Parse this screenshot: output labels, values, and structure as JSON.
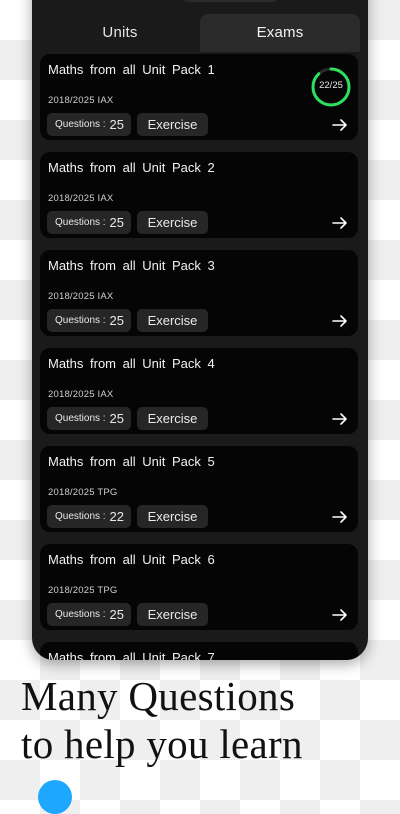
{
  "tabs": [
    {
      "label": "Units",
      "active": false
    },
    {
      "label": "Exams",
      "active": true
    }
  ],
  "cards": [
    {
      "title": "Maths from all Unit Pack 1",
      "meta": "2018/2025 IAX",
      "questions_label": "Questions :",
      "questions": "25",
      "exercise_label": "Exercise",
      "progress": {
        "text": "22/25",
        "fraction": 0.88
      }
    },
    {
      "title": "Maths from all Unit Pack 2",
      "meta": "2018/2025 IAX",
      "questions_label": "Questions :",
      "questions": "25",
      "exercise_label": "Exercise"
    },
    {
      "title": "Maths from all Unit Pack 3",
      "meta": "2018/2025 IAX",
      "questions_label": "Questions :",
      "questions": "25",
      "exercise_label": "Exercise"
    },
    {
      "title": "Maths from all Unit Pack 4",
      "meta": "2018/2025 IAX",
      "questions_label": "Questions :",
      "questions": "25",
      "exercise_label": "Exercise"
    },
    {
      "title": "Maths from all Unit Pack 5",
      "meta": "2018/2025 TPG",
      "questions_label": "Questions :",
      "questions": "22",
      "exercise_label": "Exercise"
    },
    {
      "title": "Maths from all Unit Pack 6",
      "meta": "2018/2025 TPG",
      "questions_label": "Questions :",
      "questions": "25",
      "exercise_label": "Exercise"
    },
    {
      "title": "Maths from all Unit Pack 7"
    }
  ],
  "caption": {
    "line1": "Many Questions",
    "line2": "to help you learn"
  },
  "colors": {
    "progress_ring": "#2ee05f",
    "card_bg": "#050505",
    "phone_bg": "#1a1a1a",
    "accent_dot": "#1ea7ff"
  },
  "icons": {
    "card_action": "arrow-right-icon"
  }
}
